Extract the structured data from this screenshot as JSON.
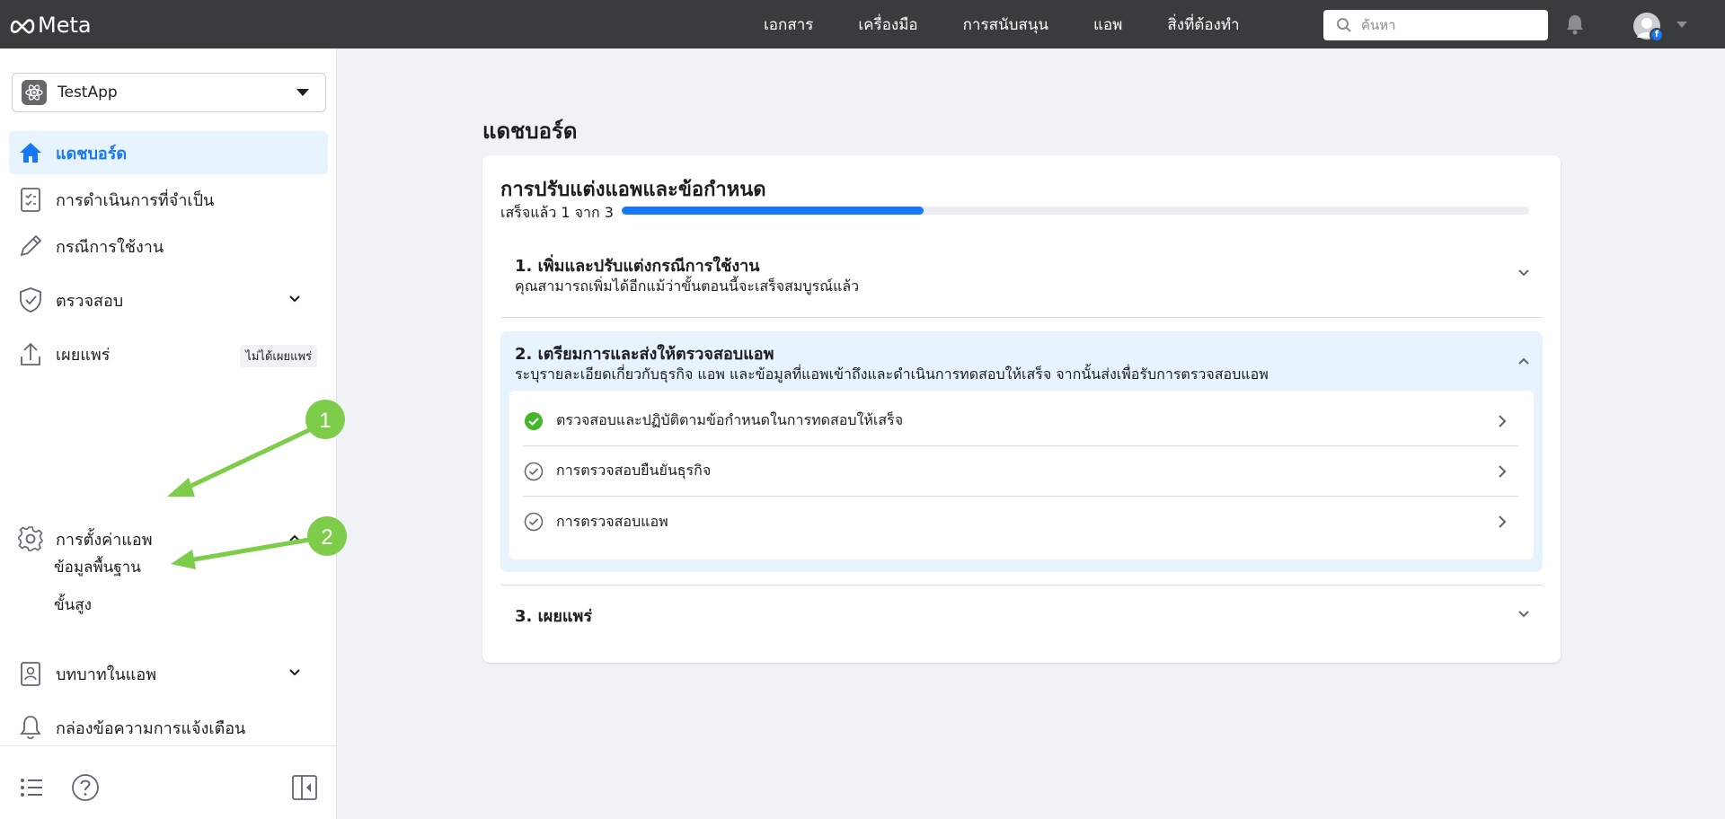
{
  "topbar": {
    "brand": "Meta",
    "nav": [
      "เอกสาร",
      "เครื่องมือ",
      "การสนับสนุน",
      "แอพ",
      "สิ่งที่ต้องทำ"
    ],
    "search_placeholder": "ค้นหา"
  },
  "sidebar": {
    "app_name": "TestApp",
    "items": [
      {
        "label": "แดชบอร์ด",
        "icon": "home-icon",
        "active": true
      },
      {
        "label": "การดำเนินการที่จำเป็น",
        "icon": "clipboard-icon"
      },
      {
        "label": "กรณีการใช้งาน",
        "icon": "pencil-icon"
      },
      {
        "label": "ตรวจสอบ",
        "icon": "shield-check-icon",
        "expandable": true
      },
      {
        "label": "เผยแพร่",
        "icon": "upload-icon",
        "badge": "ไม่ได้เผยแพร่"
      },
      {
        "label": "การตั้งค่าแอพ",
        "icon": "gear-icon",
        "expanded": true
      },
      {
        "label": "บทบาทในแอพ",
        "icon": "id-badge-icon",
        "expandable": true
      },
      {
        "label": "กล่องข้อความการแจ้งเตือน",
        "icon": "bell-icon"
      }
    ],
    "settings_sub": [
      "ข้อมูลพื้นฐาน",
      "ขั้นสูง"
    ],
    "annotations": [
      "1",
      "2"
    ]
  },
  "main": {
    "title": "แดชบอร์ด",
    "card": {
      "title": "การปรับแต่งแอพและข้อกำหนด",
      "progress_text": "เสร็จแล้ว 1 จาก 3",
      "progress_fraction": 0.333,
      "steps": [
        {
          "title": "1. เพิ่มและปรับแต่งกรณีการใช้งาน",
          "desc": "คุณสามารถเพิ่มได้อีกแม้ว่าขั้นตอนนี้จะเสร็จสมบูรณ์แล้ว"
        },
        {
          "title": "2. เตรียมการและส่งให้ตรวจสอบแอพ",
          "desc": "ระบุรายละเอียดเกี่ยวกับธุรกิจ แอพ และข้อมูลที่แอพเข้าถึงและดำเนินการทดสอบให้เสร็จ จากนั้นส่งเพื่อรับการตรวจสอบแอพ"
        },
        {
          "title": "3. เผยแพร่",
          "desc": ""
        }
      ],
      "tasks": [
        {
          "label": "ตรวจสอบและปฏิบัติตามข้อกำหนดในการทดสอบให้เสร็จ",
          "done": true
        },
        {
          "label": "การตรวจสอบยืนยันธุรกิจ",
          "done": false
        },
        {
          "label": "การตรวจสอบแอพ",
          "done": false
        }
      ]
    }
  },
  "colors": {
    "accent": "#1877f2",
    "topbar": "#3a3b3c",
    "annotation": "#7dcc4a",
    "success": "#42b72a"
  }
}
